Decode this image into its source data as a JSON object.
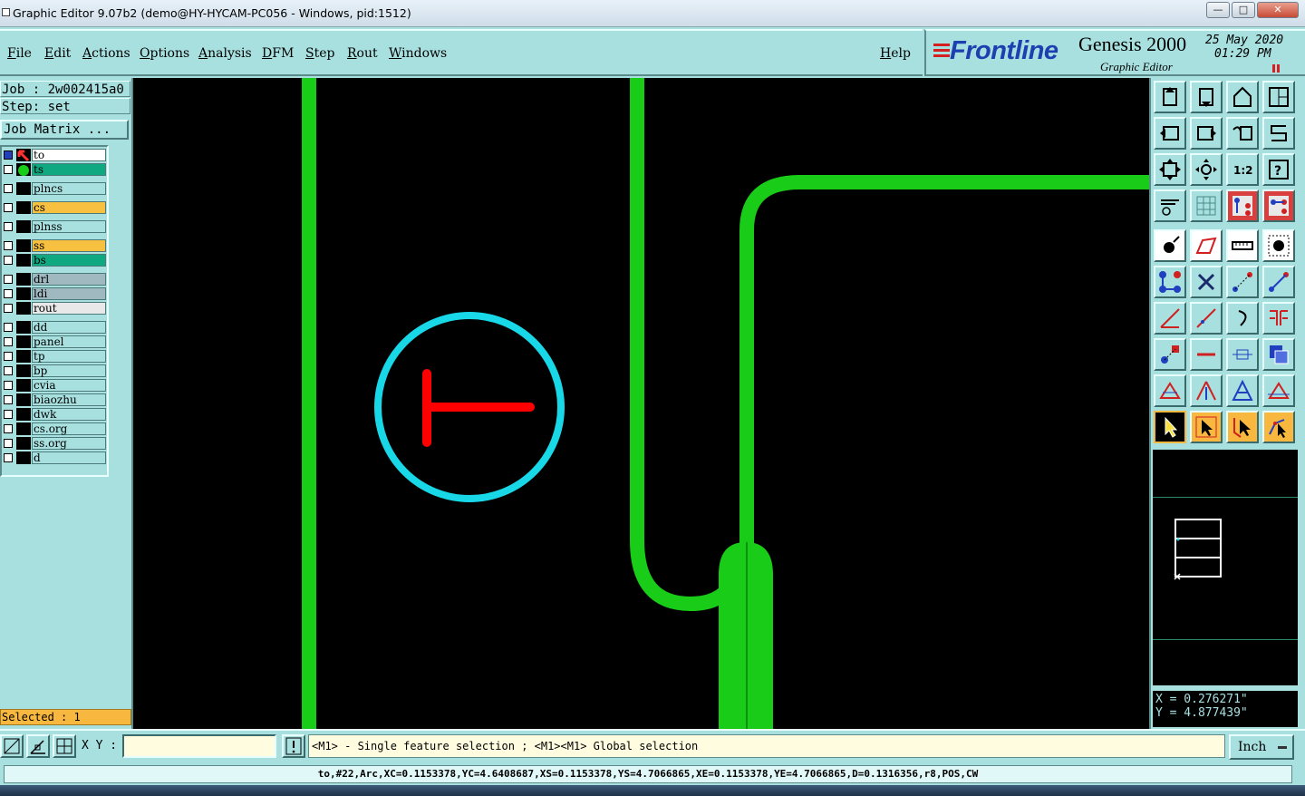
{
  "window": {
    "title": "Graphic Editor 9.07b2 (demo@HY-HYCAM-PC056 - Windows, pid:1512)",
    "minimize": "—",
    "maximize": "□",
    "close": "✕"
  },
  "menu": {
    "items": [
      "File",
      "Edit",
      "Actions",
      "Options",
      "Analysis",
      "DFM",
      "Step",
      "Rout",
      "Windows"
    ],
    "help": "Help"
  },
  "brand": {
    "logo_text": "Frontline",
    "product": "Genesis 2000",
    "subtitle": "Graphic Editor",
    "date": "25 May 2020",
    "time": "01:29 PM",
    "accent_red": "#d42020",
    "logo_blue": "#1e3fb0"
  },
  "job_info": {
    "job": "Job : 2w002415a0",
    "step": "Step: set",
    "job_matrix_button": "Job Matrix ..."
  },
  "layers": [
    {
      "name": "to",
      "color": "#ffffff",
      "marker": "edit"
    },
    {
      "name": "ts",
      "color": "#10a880",
      "marker": "display"
    },
    {
      "name": "plncs",
      "color": "#a8e0e0"
    },
    {
      "name": "cs",
      "color": "#f8c040"
    },
    {
      "name": "plnss",
      "color": "#a8e0e0"
    },
    {
      "name": "ss",
      "color": "#f8c040"
    },
    {
      "name": "bs",
      "color": "#10a880"
    },
    {
      "name": "drl",
      "color": "#a0b8c0"
    },
    {
      "name": "ldi",
      "color": "#a0b8c0"
    },
    {
      "name": "rout",
      "color": "#e8e8e8"
    },
    {
      "name": "dd",
      "color": "#a8e0e0"
    },
    {
      "name": "panel",
      "color": "#a8e0e0"
    },
    {
      "name": "tp",
      "color": "#a8e0e0"
    },
    {
      "name": "bp",
      "color": "#a8e0e0"
    },
    {
      "name": "cvia",
      "color": "#a8e0e0"
    },
    {
      "name": "biaozhu",
      "color": "#a8e0e0"
    },
    {
      "name": "dwk",
      "color": "#a8e0e0"
    },
    {
      "name": "cs.org",
      "color": "#a8e0e0"
    },
    {
      "name": "ss.org",
      "color": "#a8e0e0"
    },
    {
      "name": "d",
      "color": "#a8e0e0"
    }
  ],
  "selected_label": "Selected : 1",
  "canvas_colors": {
    "trace": "#18cc18",
    "highlight_circle": "#18d8e8",
    "selected_feature": "#ff0000",
    "background": "#000000"
  },
  "coords": {
    "x": "X = 0.276271\"",
    "y": "Y = 4.877439\""
  },
  "command": {
    "xy_label": "X Y :",
    "xy_value": "",
    "message": "<M1> - Single feature selection ; <M1><M1> Global selection",
    "unit": "Inch"
  },
  "feature_info": "to,#22,Arc,XC=0.1153378,YC=4.6408687,XS=0.1153378,YS=4.7066865,XE=0.1153378,YE=4.7066865,D=0.1316356,r8,POS,CW"
}
